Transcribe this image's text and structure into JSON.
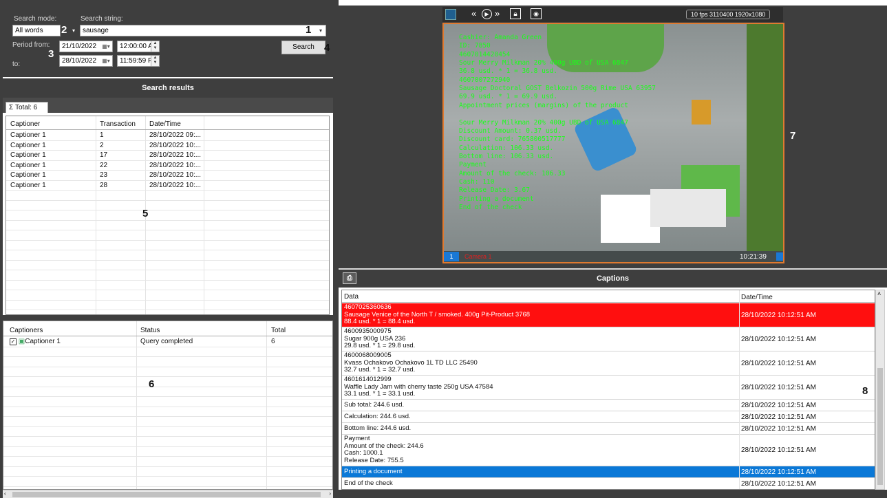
{
  "search": {
    "mode_label": "Search mode:",
    "mode_value": "All words",
    "string_label": "Search string:",
    "string_value": "sausage",
    "period_from_label": "Period from:",
    "to_label": "to:",
    "from_date": "21/10/2022",
    "from_time": "12:00:00 A",
    "to_date": "28/10/2022",
    "to_time": "11:59:59 P",
    "search_button": "Search"
  },
  "callouts": {
    "c1": "1",
    "c2": "2",
    "c3": "3",
    "c4": "4",
    "c5": "5",
    "c6": "6",
    "c7": "7",
    "c8": "8"
  },
  "results": {
    "header": "Search results",
    "tab_label": "Total: 6",
    "columns": [
      "Captioner",
      "Transaction",
      "Date/Time"
    ],
    "rows": [
      [
        "Captioner 1",
        "1",
        "28/10/2022 09:..."
      ],
      [
        "Captioner 1",
        "2",
        "28/10/2022 10:..."
      ],
      [
        "Captioner 1",
        "17",
        "28/10/2022 10:..."
      ],
      [
        "Captioner 1",
        "22",
        "28/10/2022 10:..."
      ],
      [
        "Captioner 1",
        "23",
        "28/10/2022 10:..."
      ],
      [
        "Captioner 1",
        "28",
        "28/10/2022 10:..."
      ]
    ]
  },
  "captioners": {
    "columns": [
      "Captioners",
      "Status",
      "Total"
    ],
    "rows": [
      [
        "Captioner 1",
        "Query completed",
        "6"
      ]
    ]
  },
  "video": {
    "stream_info": "10 fps 3110400 1920x1080",
    "camera_number": "1",
    "camera_name": "Camera 1",
    "timestamp": "10:21:39",
    "overlay_lines": [
      "Cashier: Amanda Green",
      " ID: 7850",
      " 4607014420454",
      " Sour Merry Milkman 20% 400g UBD of USA 6847",
      " 36.8 usd. * 1 = 36.8 usd.",
      " 4607007272940",
      " Sausage Doctoral GOST Belkozin 500g Rime USA 63957",
      " 69.9 usd. * 1 = 69.9 usd.",
      "Appointment prices (margins) of the product",
      "",
      " Sour Merry Milkman 20% 400g UBD of USA 6847",
      "Discount Amount: 0.37 usd.",
      "Discount card: 765800517777",
      "Calculation: 106.33 usd.",
      "Bottom line: 106.33 usd.",
      "Payment",
      "Amount of the check: 106.33",
      "Cash: 110",
      "Release Date: 3.67",
      "Printing a document",
      "End of the check"
    ]
  },
  "captions": {
    "header": "Captions",
    "columns": [
      "Data",
      "Date/Time"
    ],
    "rows": [
      {
        "data": "4607025360636\nSausage Venice of the North T / smoked. 400g Pit-Product 3768\n88.4 usd. * 1 = 88.4 usd.",
        "date": "28/10/2022 10:12:51 AM"
      },
      {
        "data": "4600935000975\nSugar 900g USA 236\n29.8 usd. * 1 = 29.8 usd.",
        "date": "28/10/2022 10:12:51 AM"
      },
      {
        "data": "4600068009005\nKvass Ochakovo Ochakovo 1L TD LLC 25490\n32.7 usd. * 1 = 32.7 usd.",
        "date": "28/10/2022 10:12:51 AM"
      },
      {
        "data": "4601614012999\nWaffle Lady Jam with cherry taste 250g USA 47584\n33.1 usd. * 1 = 33.1 usd.",
        "date": "28/10/2022 10:12:51 AM"
      },
      {
        "data": "Sub total: 244.6 usd.",
        "date": "28/10/2022 10:12:51 AM"
      },
      {
        "data": "Calculation: 244.6 usd.",
        "date": "28/10/2022 10:12:51 AM"
      },
      {
        "data": "Bottom line: 244.6 usd.",
        "date": "28/10/2022 10:12:51 AM"
      },
      {
        "data": "Payment\nAmount of the check: 244.6\nCash: 1000.1\nRelease Date: 755.5",
        "date": "28/10/2022 10:12:51 AM"
      },
      {
        "data": "Printing a document",
        "date": "28/10/2022 10:12:51 AM"
      },
      {
        "data": "End of the check",
        "date": "28/10/2022 10:12:51 AM"
      }
    ]
  },
  "colors": {
    "highlight_red": "#ff0f0f",
    "selected_blue": "#0a78d7",
    "panel_dark": "#3e3e3e",
    "overlay_green": "#1aff1a",
    "video_border": "#e07a30"
  }
}
